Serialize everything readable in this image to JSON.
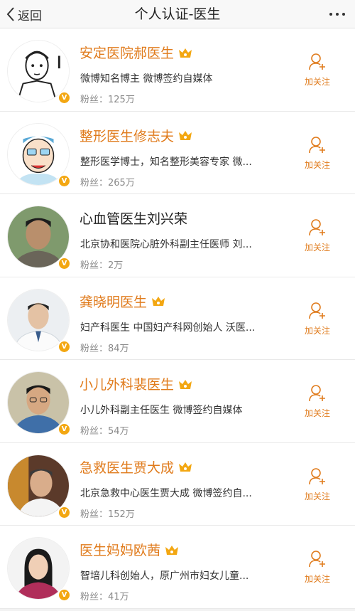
{
  "nav": {
    "back_label": "返回",
    "title": "个人认证-医生",
    "more": "•••"
  },
  "colors": {
    "accent": "#e07b1c",
    "badge": "#f3a712"
  },
  "fans_prefix": "粉丝：",
  "follow_label": "加关注",
  "icons": {
    "back": "chevron-left-icon",
    "more": "more-dots-icon",
    "follow": "add-user-icon",
    "verified": "verified-v-icon",
    "member": "crown-icon"
  },
  "doctors": [
    {
      "name": "安定医院郝医生",
      "desc": "微博知名博主 微博签约自媒体",
      "fans": "125万",
      "member": true
    },
    {
      "name": "整形医生修志夫",
      "desc": "整形医学博士，知名整形美容专家 微...",
      "fans": "265万",
      "member": true
    },
    {
      "name": "心血管医生刘兴荣",
      "desc": "北京协和医院心脏外科副主任医师 刘...",
      "fans": "2万",
      "member": false
    },
    {
      "name": "龚晓明医生",
      "desc": "妇产科医生 中国妇产科网创始人 沃医...",
      "fans": "84万",
      "member": true
    },
    {
      "name": "小儿外科裴医生",
      "desc": "小儿外科副主任医生 微博签约自媒体",
      "fans": "54万",
      "member": true
    },
    {
      "name": "急救医生贾大成",
      "desc": "北京急救中心医生贾大成 微博签约自...",
      "fans": "152万",
      "member": true
    },
    {
      "name": "医生妈妈欧茜",
      "desc": "智培儿科创始人，原广州市妇女儿童...",
      "fans": "41万",
      "member": true
    }
  ]
}
